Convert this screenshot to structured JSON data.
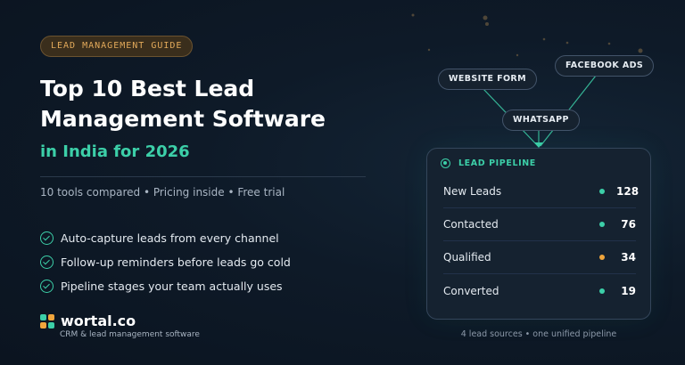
{
  "left": {
    "tag": "LEAD MANAGEMENT GUIDE",
    "title": "Top 10 Best Lead Management Software",
    "subtitle": "in India for 2026",
    "meta": "10 tools compared • Pricing inside • Free trial",
    "features": [
      "Auto-capture leads from every channel",
      "Follow-up reminders before leads go cold",
      "Pipeline stages your team actually uses"
    ],
    "brand": {
      "name": "wortal.co",
      "tagline": "CRM & lead management software"
    }
  },
  "sources": {
    "website_form": "WEBSITE FORM",
    "facebook_ads": "FACEBOOK ADS",
    "whatsapp": "WHATSAPP"
  },
  "pipeline": {
    "title": "LEAD PIPELINE",
    "rows": [
      {
        "label": "New Leads",
        "value": "128",
        "dot_color": "#3ccfa8"
      },
      {
        "label": "Contacted",
        "value": "76",
        "dot_color": "#3ccfa8"
      },
      {
        "label": "Qualified",
        "value": "34",
        "dot_color": "#f0a53c"
      },
      {
        "label": "Converted",
        "value": "19",
        "dot_color": "#3ccfa8"
      }
    ]
  },
  "caption": "4 lead sources • one unified pipeline",
  "colors": {
    "accent": "#3ccfa8",
    "warning": "#f0a53c",
    "tag_text": "#e2a95a",
    "background": "#0e1a28",
    "brand_squares": [
      "#3ccfa8",
      "#f0a53c",
      "#f0a53c",
      "#3ccfa8"
    ]
  }
}
